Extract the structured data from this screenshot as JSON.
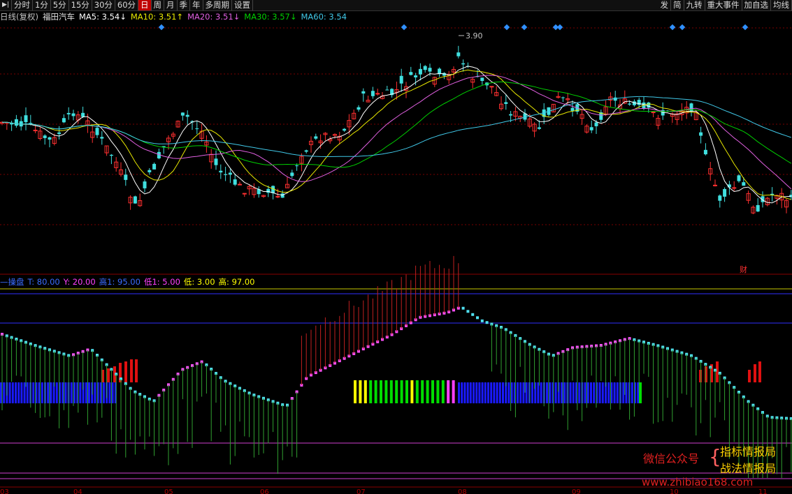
{
  "toolbar": {
    "left_items": [
      {
        "label": "分时"
      },
      {
        "label": "1分"
      },
      {
        "label": "5分"
      },
      {
        "label": "15分"
      },
      {
        "label": "30分"
      },
      {
        "label": "60分"
      },
      {
        "label": "日",
        "active": true
      },
      {
        "label": "周"
      },
      {
        "label": "月"
      },
      {
        "label": "季"
      },
      {
        "label": "年"
      },
      {
        "label": "多周期"
      },
      {
        "label": "设置"
      }
    ],
    "right_items": [
      {
        "label": "发"
      },
      {
        "label": "简"
      },
      {
        "label": "九转"
      },
      {
        "label": "重大事件"
      },
      {
        "label": "加自选"
      },
      {
        "label": "均线"
      }
    ]
  },
  "main_chart": {
    "period_label": "日线(复权)",
    "stock_name": "福田汽车",
    "ma": [
      {
        "label": "MA5:",
        "value": "3.54",
        "arrow": "↓",
        "color": "#ffffff"
      },
      {
        "label": "MA10:",
        "value": "3.51",
        "arrow": "↑",
        "color": "#e8e800"
      },
      {
        "label": "MA20:",
        "value": "3.51",
        "arrow": "↓",
        "color": "#e060e0"
      },
      {
        "label": "MA30:",
        "value": "3.57",
        "arrow": "↓",
        "color": "#00d000"
      },
      {
        "label": "MA60:",
        "value": "3.54",
        "arrow": "",
        "color": "#40c8e8"
      }
    ],
    "high_marker": "3.90",
    "fin_marker": "财"
  },
  "indicator": {
    "name": "操盘",
    "params": [
      {
        "text": "T: 80.00",
        "color": "#3a6cff"
      },
      {
        "text": "Y: 20.00",
        "color": "#ff40ff"
      },
      {
        "text": "高1: 95.00",
        "color": "#3a6cff"
      },
      {
        "text": "低1: 5.00",
        "color": "#ff40ff"
      },
      {
        "text": "低: 3.00",
        "color": "#ffff00"
      },
      {
        "text": "高: 97.00",
        "color": "#ffff00"
      }
    ]
  },
  "date_axis": [
    "03",
    "04",
    "05",
    "06",
    "07",
    "08",
    "09",
    "10",
    "11"
  ],
  "watermark": {
    "wechat": "微信公众号",
    "line1": "指标情报局",
    "line2": "战法情报局",
    "url": "www.zhibiao168.com"
  },
  "colors": {
    "up": "#ff3030",
    "down": "#40e0e0",
    "ma5": "#ffffff",
    "ma10": "#e8e800",
    "ma20": "#e060e0",
    "ma30": "#00d000",
    "ma60": "#40c8e8"
  }
}
